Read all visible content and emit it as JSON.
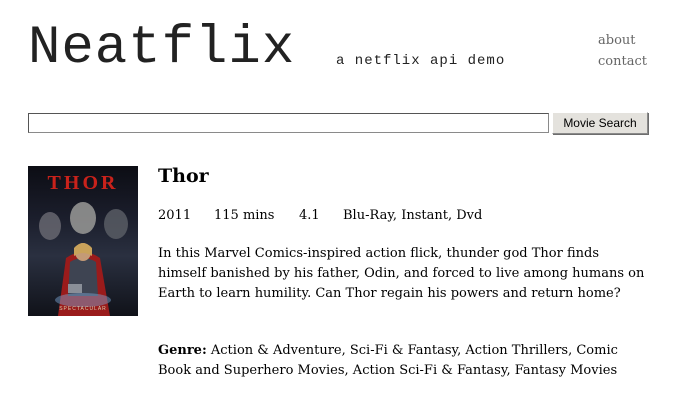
{
  "header": {
    "brand": "Neatflix",
    "tagline": "a netflix api demo",
    "nav": [
      {
        "label": "about"
      },
      {
        "label": "contact"
      }
    ]
  },
  "search": {
    "value": "",
    "placeholder": "",
    "button_label": "Movie Search"
  },
  "movie": {
    "poster_title": "THOR",
    "poster_footer": "SPECTACULAR",
    "title": "Thor",
    "year": "2011",
    "runtime": "115 mins",
    "rating": "4.1",
    "formats": "Blu-Ray, Instant, Dvd",
    "description": "In this Marvel Comics-inspired action flick, thunder god Thor finds himself banished by his father, Odin, and forced to live among humans on Earth to learn humility. Can Thor regain his powers and return home?",
    "genre_label": "Genre:",
    "genres": "Action & Adventure, Sci-Fi & Fantasy, Action Thrillers, Comic Book and Superhero Movies, Action Sci-Fi & Fantasy, Fantasy Movies"
  }
}
